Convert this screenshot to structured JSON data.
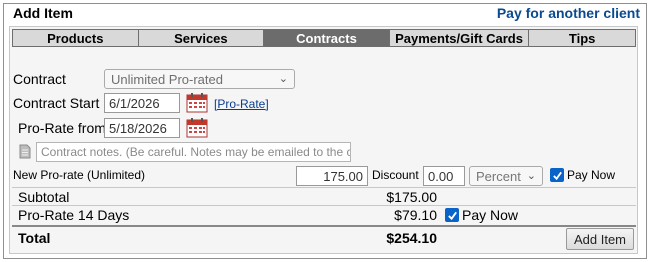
{
  "header": {
    "title": "Add Item",
    "link": "Pay for another client"
  },
  "tabs": [
    {
      "label": "Products",
      "active": false
    },
    {
      "label": "Services",
      "active": false
    },
    {
      "label": "Contracts",
      "active": true
    },
    {
      "label": "Payments/Gift Cards",
      "active": false
    },
    {
      "label": "Tips",
      "active": false
    }
  ],
  "form": {
    "contract_label": "Contract",
    "contract_value": "Unlimited Pro-rated",
    "contract_start_label": "Contract Start",
    "contract_start_value": "6/1/2026",
    "prorate_link": "[Pro-Rate]",
    "prorate_from_label": "Pro-Rate from",
    "prorate_from_value": "5/18/2026",
    "notes_placeholder": "Contract notes. (Be careful. Notes may be emailed to the client.)"
  },
  "line_item": {
    "name": "New Pro-rate (Unlimited)",
    "price": "175.00",
    "discount_label": "Discount",
    "discount_value": "0.00",
    "discount_type": "Percent",
    "pay_now_label": "Pay Now",
    "pay_now_checked": true
  },
  "summary": {
    "subtotal_label": "Subtotal",
    "subtotal_value": "$175.00",
    "prorate_label": "Pro-Rate 14 Days",
    "prorate_value": "$79.10",
    "prorate_pay_now_label": "Pay Now",
    "prorate_pay_now_checked": true,
    "total_label": "Total",
    "total_value": "$254.10"
  },
  "actions": {
    "add_item": "Add Item"
  },
  "colors": {
    "link": "#0a4a8f",
    "active_tab": "#6c6c6c",
    "checkbox": "#0a63c9"
  }
}
